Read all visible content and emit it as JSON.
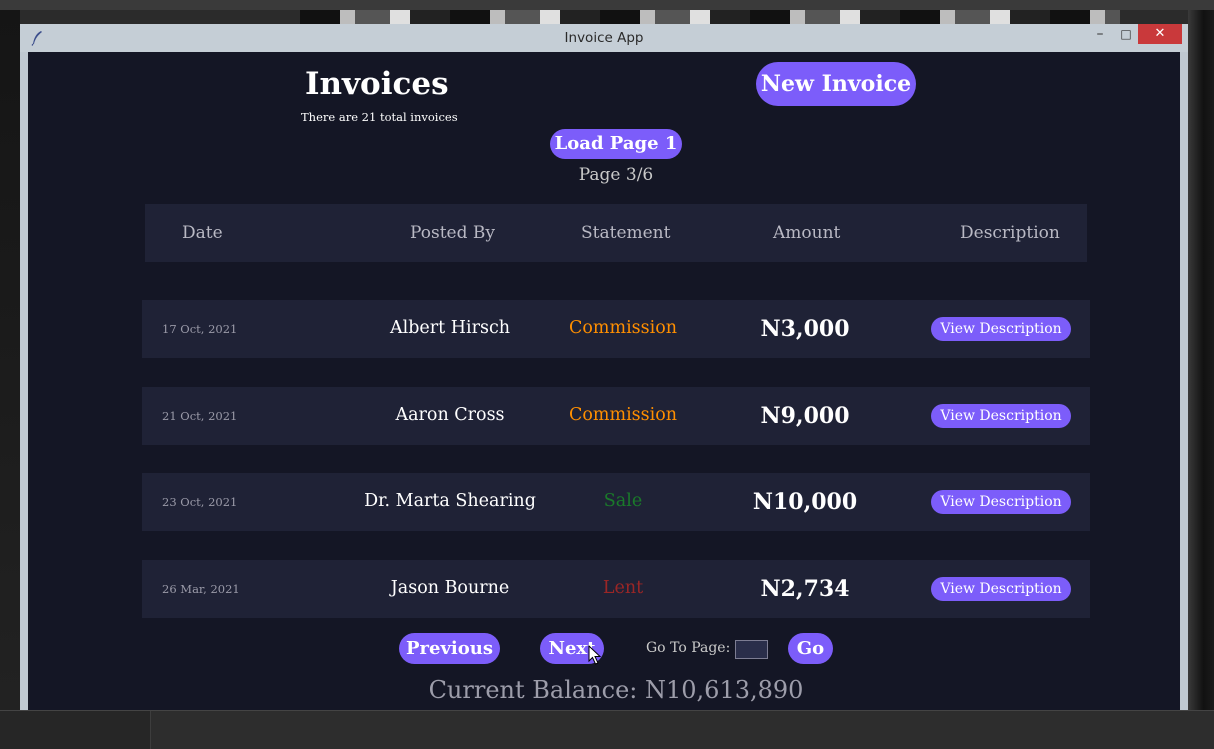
{
  "window": {
    "title": "Invoice App",
    "minimize_glyph": "–",
    "maximize_glyph": "□",
    "close_glyph": "✕"
  },
  "header": {
    "title": "Invoices",
    "subtitle": "There are 21 total invoices",
    "new_invoice_label": "New Invoice",
    "load_page_label": "Load Page 1",
    "page_indicator": "Page 3/6"
  },
  "table": {
    "columns": [
      "Date",
      "Posted By",
      "Statement",
      "Amount",
      "Description"
    ],
    "rows": [
      {
        "date": "17 Oct, 2021",
        "posted_by": "Albert Hirsch",
        "statement": "Commission",
        "amount": "N3,000",
        "action": "View Description"
      },
      {
        "date": "21 Oct, 2021",
        "posted_by": "Aaron Cross",
        "statement": "Commission",
        "amount": "N9,000",
        "action": "View Description"
      },
      {
        "date": "23 Oct, 2021",
        "posted_by": "Dr. Marta Shearing",
        "statement": "Sale",
        "amount": "N10,000",
        "action": "View Description"
      },
      {
        "date": "26 Mar, 2021",
        "posted_by": "Jason Bourne",
        "statement": "Lent",
        "amount": "N2,734",
        "action": "View Description"
      }
    ]
  },
  "pagination": {
    "previous_label": "Previous",
    "next_label": "Next",
    "goto_label": "Go To Page:",
    "goto_value": "",
    "go_label": "Go"
  },
  "footer": {
    "balance": "Current Balance: N10,613,890"
  },
  "colors": {
    "background": "#141625",
    "row_background": "#1f2236",
    "accent": "#7c5dfa",
    "commission": "#ff8f00",
    "sale": "#1a7a2a",
    "lent": "#9a2626",
    "close_button": "#c9393b"
  },
  "icons": {
    "app": "feather-icon",
    "cursor": "mouse-pointer-icon"
  }
}
